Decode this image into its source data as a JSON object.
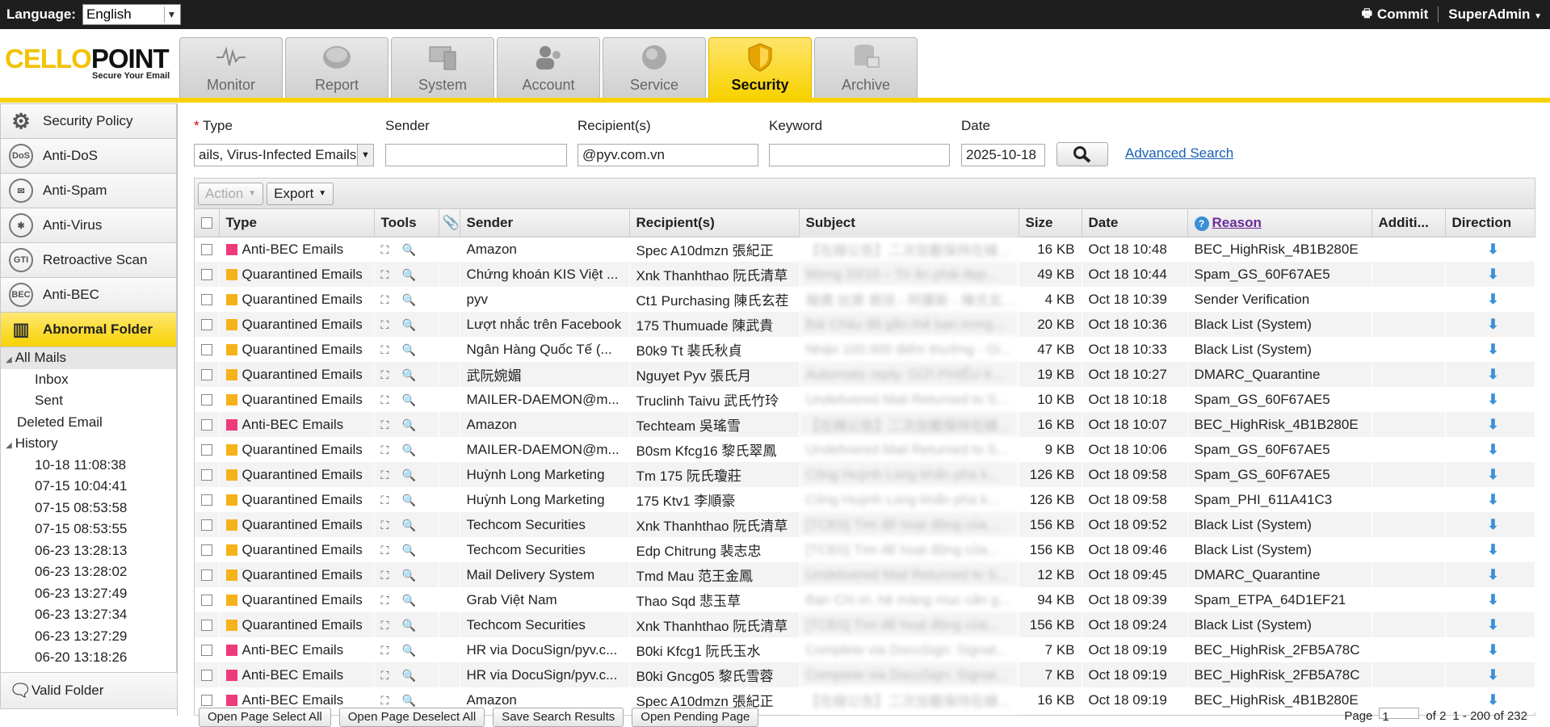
{
  "topbar": {
    "language_label": "Language:",
    "language_value": "English",
    "commit_label": "Commit",
    "user_label": "SuperAdmin"
  },
  "logo": {
    "text_cello": "CELLO",
    "text_point": "POINT",
    "tagline": "Secure Your Email"
  },
  "tabs": [
    {
      "label": "Monitor",
      "icon": "waveform-icon"
    },
    {
      "label": "Report",
      "icon": "disc-icon"
    },
    {
      "label": "System",
      "icon": "computer-icon"
    },
    {
      "label": "Account",
      "icon": "users-icon"
    },
    {
      "label": "Service",
      "icon": "globe-icon"
    },
    {
      "label": "Security",
      "icon": "shield-icon"
    },
    {
      "label": "Archive",
      "icon": "database-icon"
    }
  ],
  "sidebar": {
    "items": [
      {
        "label": "Security Policy",
        "icon": "gear-icon"
      },
      {
        "label": "Anti-DoS",
        "icon": "dos-icon"
      },
      {
        "label": "Anti-Spam",
        "icon": "envelope-icon"
      },
      {
        "label": "Anti-Virus",
        "icon": "virus-icon"
      },
      {
        "label": "Retroactive Scan",
        "icon": "gti-icon"
      },
      {
        "label": "Anti-BEC",
        "icon": "bec-icon"
      },
      {
        "label": "Abnormal Folder",
        "icon": "grid-icon"
      }
    ],
    "tree": {
      "all_mails": "All Mails",
      "inbox": "Inbox",
      "sent": "Sent",
      "deleted": "Deleted Email",
      "history": "History",
      "history_items": [
        "10-18 11:08:38",
        "07-15 10:04:41",
        "07-15 08:53:58",
        "07-15 08:53:55",
        "06-23 13:28:13",
        "06-23 13:28:02",
        "06-23 13:27:49",
        "06-23 13:27:34",
        "06-23 13:27:29",
        "06-20 13:18:26"
      ]
    },
    "valid_folder": "Valid Folder"
  },
  "filters": {
    "type_label": "Type",
    "type_required_mark": "*",
    "type_value": "ails, Virus-Infected Emails",
    "sender_label": "Sender",
    "sender_value": "",
    "recipient_label": "Recipient(s)",
    "recipient_value": "@pyv.com.vn",
    "keyword_label": "Keyword",
    "keyword_value": "",
    "date_label": "Date",
    "date_value": "2025-10-18",
    "advanced_search": "Advanced Search"
  },
  "toolbar": {
    "action_label": "Action",
    "export_label": "Export"
  },
  "columns": [
    "Type",
    "Tools",
    "Sender",
    "Recipient(s)",
    "Subject",
    "Size",
    "Date",
    "Reason",
    "Additi...",
    "Direction"
  ],
  "colors": {
    "bec": "#ee3a7a",
    "quarantine": "#f5b21a",
    "accent": "#f7d200"
  },
  "rows": [
    {
      "type": "Anti-BEC Emails",
      "kind": "bec",
      "sender": "Amazon",
      "recipient": "Spec A10dmzn 張紀正",
      "subject": "【在線公告】二次加載保持在線...",
      "size": "16 KB",
      "date": "Oct 18 10:48",
      "reason": "BEC_HighRisk_4B1B280E"
    },
    {
      "type": "Quarantined Emails",
      "kind": "q",
      "sender": "Chứng khoán KIS Việt ...",
      "recipient": "Xnk Thanhthao 阮氏清草",
      "subject": "Mừng 20/10 – Tri ân phái đẹp...",
      "size": "49 KB",
      "date": "Oct 18 10:44",
      "reason": "Spam_GS_60F67AE5"
    },
    {
      "type": "Quarantined Emails",
      "kind": "q",
      "sender": "pyv",
      "recipient": "Ct1 Purchasing 陳氏玄茬",
      "subject": "報價 出貨 資訊 - 阿蘭新 - 陳氏玄 出貨",
      "size": "4 KB",
      "date": "Oct 18 10:39",
      "reason": "Sender Verification"
    },
    {
      "type": "Quarantined Emails",
      "kind": "q",
      "sender": "Lượt nhắc trên Facebook",
      "recipient": "175 Thumuade 陳武貴",
      "subject": "Bài Châu đã gắn thẻ bạn trong...",
      "size": "20 KB",
      "date": "Oct 18 10:36",
      "reason": "Black List (System)"
    },
    {
      "type": "Quarantined Emails",
      "kind": "q",
      "sender": "Ngân Hàng Quốc Tế (...",
      "recipient": "B0k9 Tt 裴氏秋貞",
      "subject": "Nhận 100.000 điểm thưởng - Gi...",
      "size": "47 KB",
      "date": "Oct 18 10:33",
      "reason": "Black List (System)"
    },
    {
      "type": "Quarantined Emails",
      "kind": "q",
      "sender": "武阮婉媚",
      "recipient": "Nguyet Pyv 張氏月",
      "subject": "Automatic reply: GỬI PHIẾU K...",
      "size": "19 KB",
      "date": "Oct 18 10:27",
      "reason": "DMARC_Quarantine"
    },
    {
      "type": "Quarantined Emails",
      "kind": "q",
      "sender": "MAILER-DAEMON@m...",
      "recipient": "Truclinh Taivu 武氏竹玲",
      "subject": "Undelivered Mail Returned to S...",
      "size": "10 KB",
      "date": "Oct 18 10:18",
      "reason": "Spam_GS_60F67AE5"
    },
    {
      "type": "Anti-BEC Emails",
      "kind": "bec",
      "sender": "Amazon",
      "recipient": "Techteam 吳瑤雪",
      "subject": "【在線公告】二次加載保持在線...",
      "size": "16 KB",
      "date": "Oct 18 10:07",
      "reason": "BEC_HighRisk_4B1B280E"
    },
    {
      "type": "Quarantined Emails",
      "kind": "q",
      "sender": "MAILER-DAEMON@m...",
      "recipient": "B0sm Kfcg16 黎氏翠鳳",
      "subject": "Undelivered Mail Returned to S...",
      "size": "9 KB",
      "date": "Oct 18 10:06",
      "reason": "Spam_GS_60F67AE5"
    },
    {
      "type": "Quarantined Emails",
      "kind": "q",
      "sender": "Huỳnh Long Marketing",
      "recipient": "Tm 175 阮氏瓊莊",
      "subject": "Công Huỳnh Long khẩn phá k...",
      "size": "126 KB",
      "date": "Oct 18 09:58",
      "reason": "Spam_GS_60F67AE5"
    },
    {
      "type": "Quarantined Emails",
      "kind": "q",
      "sender": "Huỳnh Long Marketing",
      "recipient": "175 Ktv1 李順豪",
      "subject": "Công Huỳnh Long khẩn phá k...",
      "size": "126 KB",
      "date": "Oct 18 09:58",
      "reason": "Spam_PHI_611A41C3"
    },
    {
      "type": "Quarantined Emails",
      "kind": "q",
      "sender": "Techcom Securities",
      "recipient": "Xnk Thanhthao 阮氏清草",
      "subject": "[TCBS] Tìm để hoạt động của...",
      "size": "156 KB",
      "date": "Oct 18 09:52",
      "reason": "Black List (System)"
    },
    {
      "type": "Quarantined Emails",
      "kind": "q",
      "sender": "Techcom Securities",
      "recipient": "Edp Chitrung 裴志忠",
      "subject": "[TCBS] Tìm để hoạt động của...",
      "size": "156 KB",
      "date": "Oct 18 09:46",
      "reason": "Black List (System)"
    },
    {
      "type": "Quarantined Emails",
      "kind": "q",
      "sender": "Mail Delivery System",
      "recipient": "Tmd Mau 范王金鳳",
      "subject": "Undelivered Mail Returned to S...",
      "size": "12 KB",
      "date": "Oct 18 09:45",
      "reason": "DMARC_Quarantine"
    },
    {
      "type": "Quarantined Emails",
      "kind": "q",
      "sender": "Grab Việt Nam",
      "recipient": "Thao Sqd 悲玉草",
      "subject": "Bạn Chi ơi, hệ màng mục cần g...",
      "size": "94 KB",
      "date": "Oct 18 09:39",
      "reason": "Spam_ETPA_64D1EF21"
    },
    {
      "type": "Quarantined Emails",
      "kind": "q",
      "sender": "Techcom Securities",
      "recipient": "Xnk Thanhthao 阮氏清草",
      "subject": "[TCBS] Tìm để hoạt động của...",
      "size": "156 KB",
      "date": "Oct 18 09:24",
      "reason": "Black List (System)"
    },
    {
      "type": "Anti-BEC Emails",
      "kind": "bec",
      "sender": "HR via DocuSign/pyv.c...",
      "recipient": "B0ki Kfcg1 阮氏玉水",
      "subject": "Complete via DocuSign: Signat...",
      "size": "7 KB",
      "date": "Oct 18 09:19",
      "reason": "BEC_HighRisk_2FB5A78C"
    },
    {
      "type": "Anti-BEC Emails",
      "kind": "bec",
      "sender": "HR via DocuSign/pyv.c...",
      "recipient": "B0ki Gncg05 黎氏雪蓉",
      "subject": "Complete via DocuSign: Signat...",
      "size": "7 KB",
      "date": "Oct 18 09:19",
      "reason": "BEC_HighRisk_2FB5A78C"
    },
    {
      "type": "Anti-BEC Emails",
      "kind": "bec",
      "sender": "Amazon",
      "recipient": "Spec A10dmzn 張紀正",
      "subject": "【在線公告】二次加載保持在線...",
      "size": "16 KB",
      "date": "Oct 18 09:19",
      "reason": "BEC_HighRisk_4B1B280E"
    }
  ],
  "bottom": {
    "buttons": [
      "Open Page Select All",
      "Open Page Deselect All",
      "Save Search Results",
      "Open Pending Page"
    ],
    "page_label": "Page",
    "page_value": "1",
    "page_of": "of 2",
    "range": "1 - 200 of 232"
  }
}
